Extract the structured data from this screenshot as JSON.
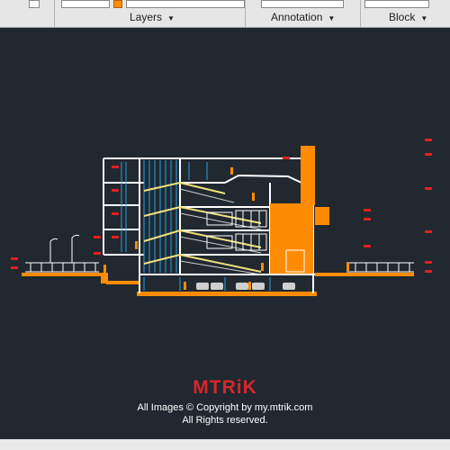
{
  "ribbon": {
    "panels": [
      {
        "label": "Layers"
      },
      {
        "label": "Annotation"
      },
      {
        "label": "Block"
      }
    ]
  },
  "watermark": {
    "logo": "MTRiK",
    "line1": "All Images © Copyright by my.mtrik.com",
    "line2": "All Rights reserved."
  },
  "colors": {
    "canvas": "#212830",
    "structure": "#ffffff",
    "accent": "#ff8c00",
    "ramp": "#f2e27a",
    "glazing": "#23a4e6",
    "annotation": "#e02020",
    "brand": "#d9262b"
  }
}
